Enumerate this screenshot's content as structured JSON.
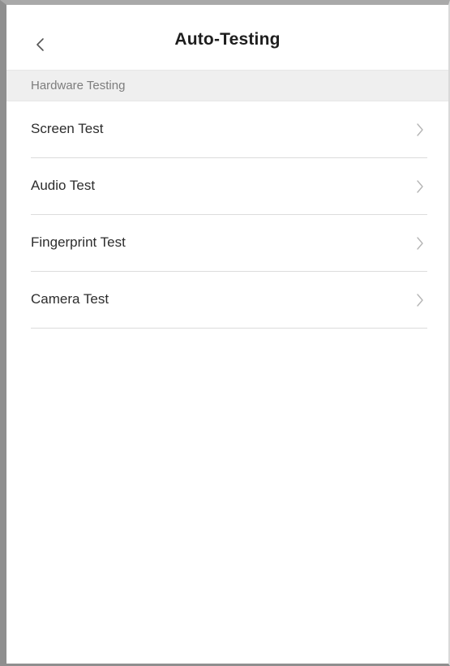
{
  "header": {
    "title": "Auto-Testing",
    "back_icon": "chevron-left-icon"
  },
  "section": {
    "label": "Hardware Testing"
  },
  "items": [
    {
      "label": "Screen Test",
      "icon": "chevron-right-icon"
    },
    {
      "label": "Audio Test",
      "icon": "chevron-right-icon"
    },
    {
      "label": "Fingerprint Test",
      "icon": "chevron-right-icon"
    },
    {
      "label": "Camera Test",
      "icon": "chevron-right-icon"
    }
  ],
  "colors": {
    "section_background": "#efefef",
    "divider": "#dcdcdc",
    "title_text": "#1e1e1e",
    "item_text": "#2d2d2d",
    "section_text": "#7d7d7d",
    "chevron": "#b5b5b5"
  }
}
